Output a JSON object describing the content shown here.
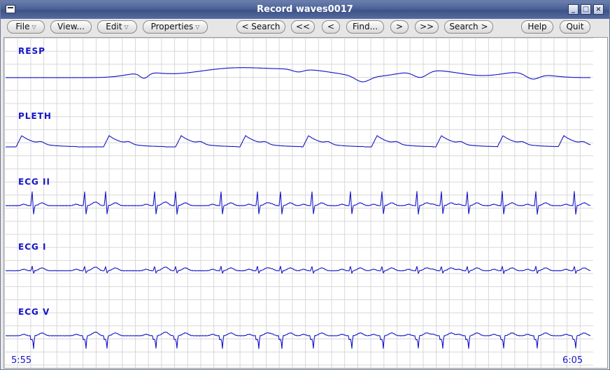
{
  "window": {
    "title": "Record waves0017"
  },
  "toolbar": {
    "file": "File",
    "view": "View...",
    "edit": "Edit",
    "properties": "Properties",
    "search_back": "< Search",
    "prev_page": "<<",
    "prev": "<",
    "find": "Find...",
    "next": ">",
    "next_page": ">>",
    "search_fwd": "Search >",
    "help": "Help",
    "quit": "Quit"
  },
  "signals": [
    {
      "name": "RESP"
    },
    {
      "name": "PLETH"
    },
    {
      "name": "ECG II"
    },
    {
      "name": "ECG I"
    },
    {
      "name": "ECG V"
    }
  ],
  "time": {
    "start": "5:55",
    "end": "6:05"
  },
  "colors": {
    "trace": "#1515c8",
    "grid": "#d8d8d8",
    "titlebar": "#4b6196"
  }
}
